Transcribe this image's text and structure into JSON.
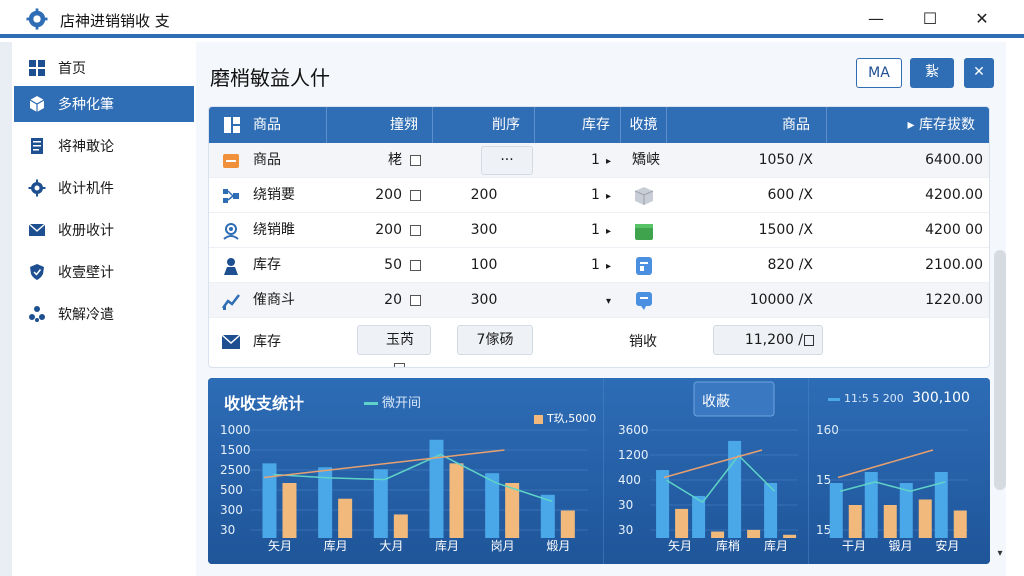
{
  "window": {
    "title": "店神进销销收 支",
    "controls": {
      "minimize": "—",
      "maximize": "☐",
      "close": "✕"
    }
  },
  "sidebar": {
    "items": [
      {
        "label": "首页",
        "icon": "grid-icon"
      },
      {
        "label": "多种化筆",
        "icon": "box-icon",
        "active": true
      },
      {
        "label": "将神敢论",
        "icon": "doc-icon"
      },
      {
        "label": "收计机件",
        "icon": "gear-icon"
      },
      {
        "label": "收册收计",
        "icon": "mail-icon"
      },
      {
        "label": "收壹壁计",
        "icon": "shield-icon"
      },
      {
        "label": "软解冷遣",
        "icon": "cluster-icon"
      }
    ]
  },
  "header": {
    "title": "磨梢敏益人什",
    "buttons": [
      {
        "label": "MA"
      },
      {
        "label": "紥"
      },
      {
        "label": "✕"
      }
    ]
  },
  "table": {
    "columns": [
      "商品",
      "撞翙",
      "削序",
      "库存",
      "收摬",
      "商品",
      "▸ 库存拔数"
    ],
    "rows": [
      {
        "name": "商品",
        "c1": "栳",
        "c2": "···",
        "c3": "1",
        "c4": "矯峡",
        "c5": "1050 /X",
        "c6": "6400.00",
        "icon": "store-icon"
      },
      {
        "name": "绕销要",
        "c1": "200",
        "c2": "200",
        "c3": "1",
        "c4": "",
        "c5": "600 /X",
        "c6": "4200.00",
        "icon": "network-icon"
      },
      {
        "name": "绕销睢",
        "c1": "200",
        "c2": "300",
        "c3": "1",
        "c4": "",
        "c5": "1500 /X",
        "c6": "4200 00",
        "icon": "user-settings-icon"
      },
      {
        "name": "库存",
        "c1": "50",
        "c2": "100",
        "c3": "1",
        "c4": "",
        "c5": "820 /X",
        "c6": "2100.00",
        "icon": "person-icon"
      },
      {
        "name": "傕商斗",
        "c1": "20",
        "c2": "300",
        "c3": "",
        "c4": "",
        "c5": "10000 /X",
        "c6": "1220.00",
        "icon": "trend-icon"
      }
    ],
    "summary": {
      "name": "库存",
      "box1": "玉芮",
      "box2": "7傢砀",
      "label": "销收",
      "total": "11,200 /"
    }
  },
  "dashboard": {
    "title": "收收支统计",
    "legend1": "微开间",
    "legend2": "T玖,5000",
    "panel2_title": "收蔽",
    "legend3": "11:5 5 200",
    "legend3_value": "300,100"
  },
  "chart_data": [
    {
      "type": "bar",
      "categories": [
        "矢月",
        "库月",
        "大月",
        "库月",
        "岗月",
        "煅月"
      ],
      "yticks": [
        "1000",
        "1500",
        "2500",
        "500",
        "300",
        "30"
      ],
      "series": [
        {
          "values": [
            1900,
            1800,
            1750,
            2500,
            1650,
            1100
          ]
        },
        {
          "values": [
            1400,
            1000,
            600,
            1900,
            1400,
            700
          ]
        }
      ],
      "colors": [
        "#4aa8e8",
        "#f2b97c"
      ]
    },
    {
      "type": "bar",
      "categories": [
        "矢月",
        "库梢",
        "库月"
      ],
      "yticks": [
        "3600",
        "1200",
        "400",
        "30",
        "30"
      ],
      "series": [
        {
          "values": [
            2100,
            1300,
            3000,
            1700
          ]
        },
        {
          "values": [
            900,
            200,
            250,
            100
          ]
        }
      ],
      "colors": [
        "#4aa8e8",
        "#f2b97c"
      ]
    },
    {
      "type": "bar",
      "categories": [
        "干月",
        "锻月",
        "安月"
      ],
      "yticks": [
        "160",
        "15",
        "15"
      ],
      "series": [
        {
          "values": [
            50,
            60,
            50,
            60
          ]
        },
        {
          "values": [
            30,
            30,
            35,
            25
          ]
        }
      ],
      "colors": [
        "#4aa8e8",
        "#f2b97c"
      ]
    }
  ]
}
